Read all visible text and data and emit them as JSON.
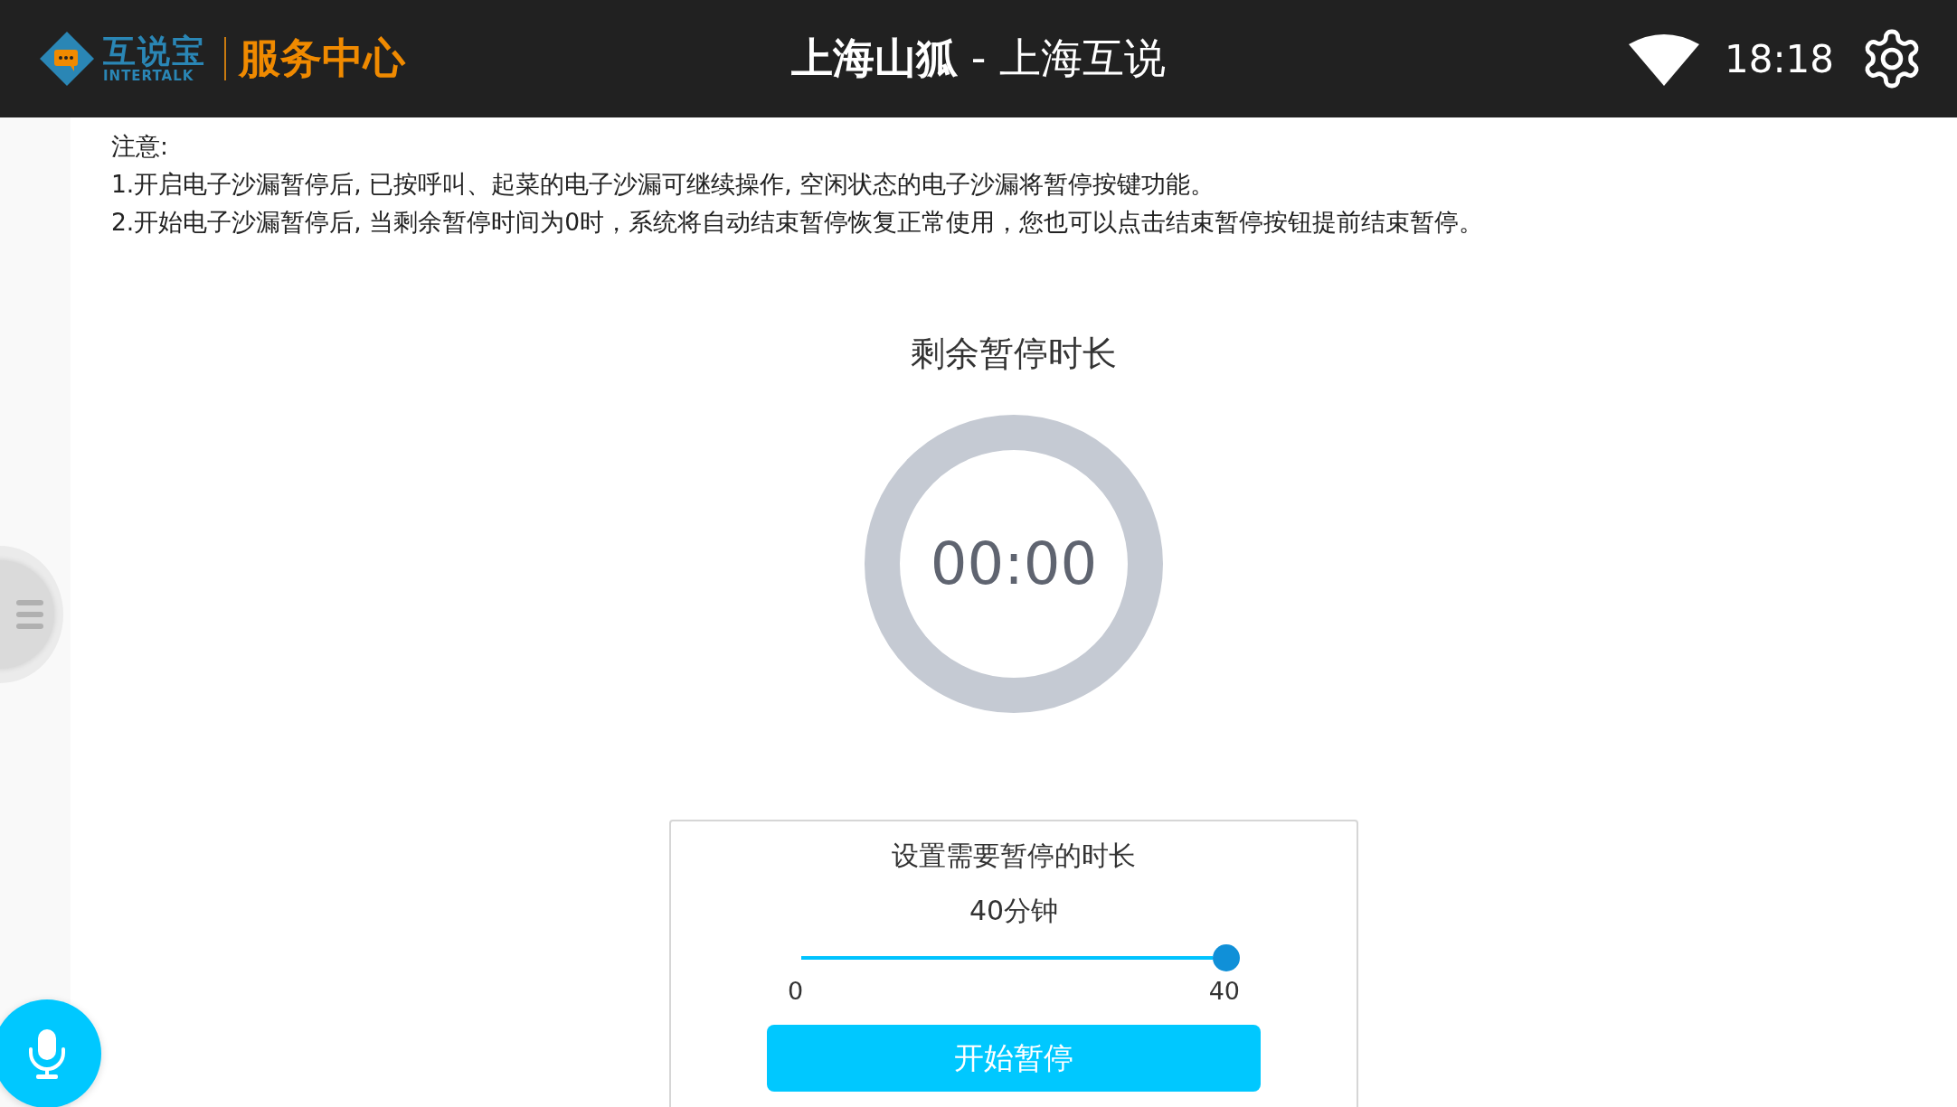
{
  "header": {
    "logo": {
      "name": "互说宝",
      "subtitle": "INTERTALK"
    },
    "section": "服务中心",
    "title": "**上海山狐** - 上海互说",
    "time": "18:18"
  },
  "notice": {
    "heading": "注意:",
    "lines": [
      "1.开启电子沙漏暂停后, 已按呼叫、起菜的电子沙漏可继续操作, 空闲状态的电子沙漏将暂停按键功能。",
      "2.开始电子沙漏暂停后, 当剩余暂停时间为0时，系统将自动结束暂停恢复正常使用，您也可以点击结束暂停按钮提前结束暂停。"
    ]
  },
  "timer": {
    "label": "剩余暂停时长",
    "value": "00:00"
  },
  "duration_panel": {
    "title": "设置需要暂停的时长",
    "reading": "40分钟",
    "slider": {
      "level": 1,
      "min": "0",
      "max": "40"
    },
    "button": "开始暂停"
  }
}
